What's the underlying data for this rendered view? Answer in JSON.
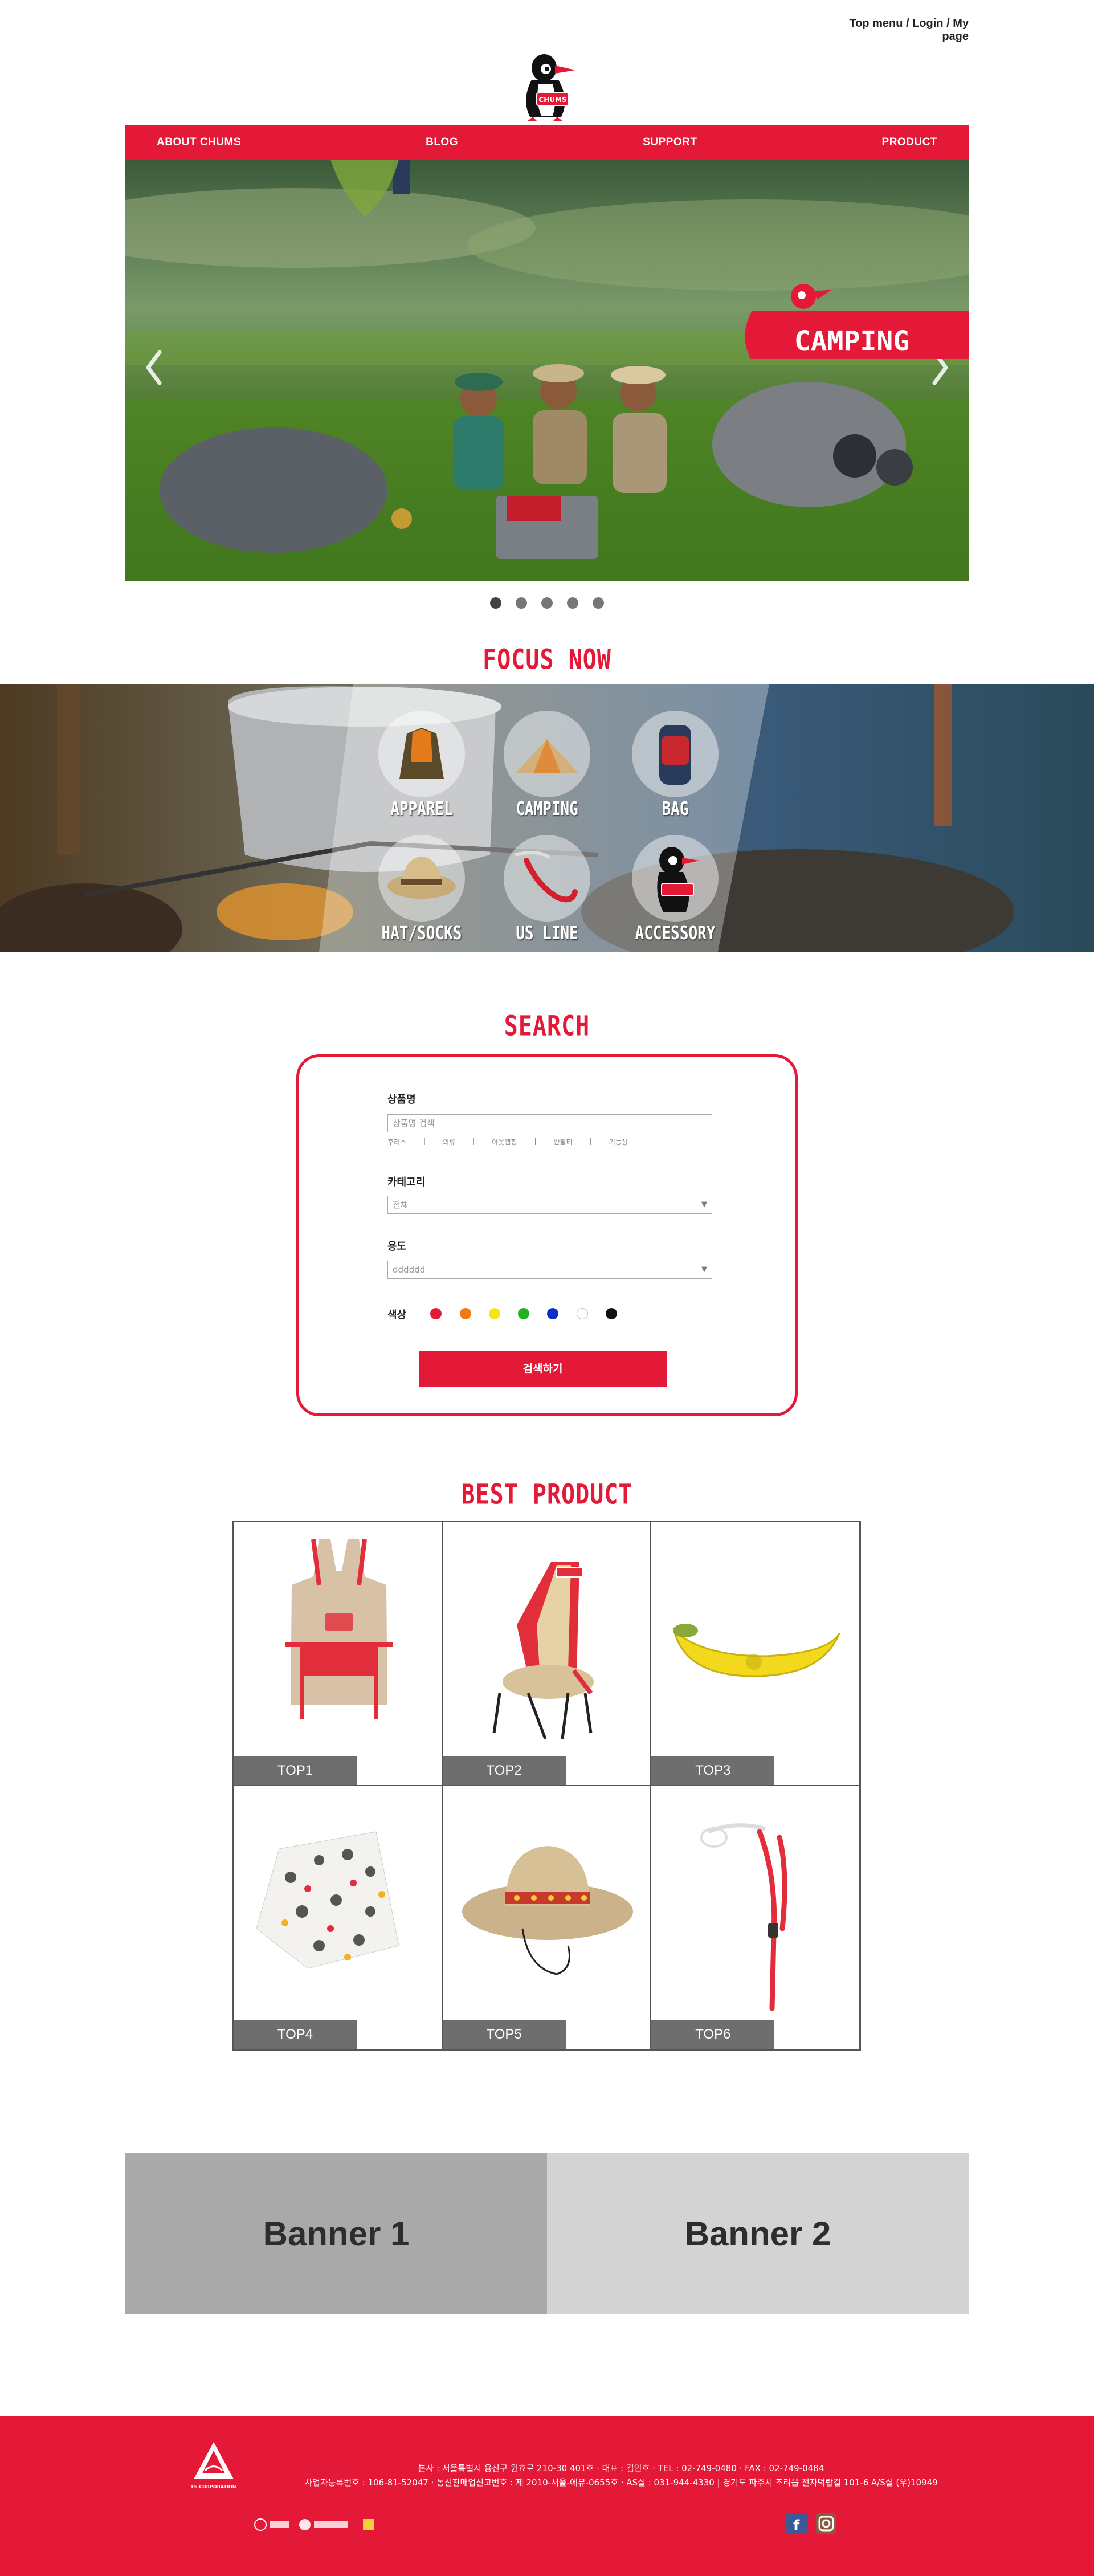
{
  "top_links": {
    "top_menu": "Top menu",
    "sep1": " / ",
    "login": "Login",
    "sep2": " / ",
    "my_page": "My page"
  },
  "logo": {
    "brand": "CHUMS"
  },
  "nav": {
    "items": [
      "ABOUT CHUMS",
      "BLOG",
      "SUPPORT",
      "PRODUCT"
    ]
  },
  "hero": {
    "badge": "CAMPING",
    "slides": 5,
    "active_slide": 1
  },
  "focus": {
    "title": "FOCUS NOW",
    "categories": [
      "APPAREL",
      "CAMPING",
      "BAG",
      "HAT/SOCKS",
      "US LINE",
      "ACCESSORY"
    ]
  },
  "search": {
    "title": "SEARCH",
    "product_name_label": "상품명",
    "product_name_placeholder": "상품명 검색",
    "keywords": [
      "후리스",
      "|",
      "의류",
      "|",
      "아웃캠핑",
      "|",
      "반팔티",
      "|",
      "기능성"
    ],
    "category_label": "카테고리",
    "category_value": "전체",
    "usage_label": "용도",
    "usage_value": "dddddd",
    "color_label": "색상",
    "colors": [
      "#e41837",
      "#f07a10",
      "#f5e21a",
      "#1db321",
      "#0a2ec9",
      "#ffffff",
      "#111111"
    ],
    "button": "검색하기"
  },
  "best": {
    "title": "BEST PRODUCT",
    "items": [
      "TOP1",
      "TOP2",
      "TOP3",
      "TOP4",
      "TOP5",
      "TOP6"
    ]
  },
  "banners": [
    "Banner 1",
    "Banner 2"
  ],
  "footer": {
    "line1": "본사 : 서울특별시 용산구 원효로 210-30 401호 · 대표 : 김인호 · TEL : 02-749-0480 · FAX : 02-749-0484",
    "line2": "사업자등록번호 : 106-81-52047 · 통신판매업신고번호 : 제 2010-서울-에뮤-0655호 · AS실 : 031-944-4330 | 경기도 파주시 조리읍 전자덕랍길 101-6 A/S실 (우)10949",
    "corp": "LS CORPORATION"
  }
}
